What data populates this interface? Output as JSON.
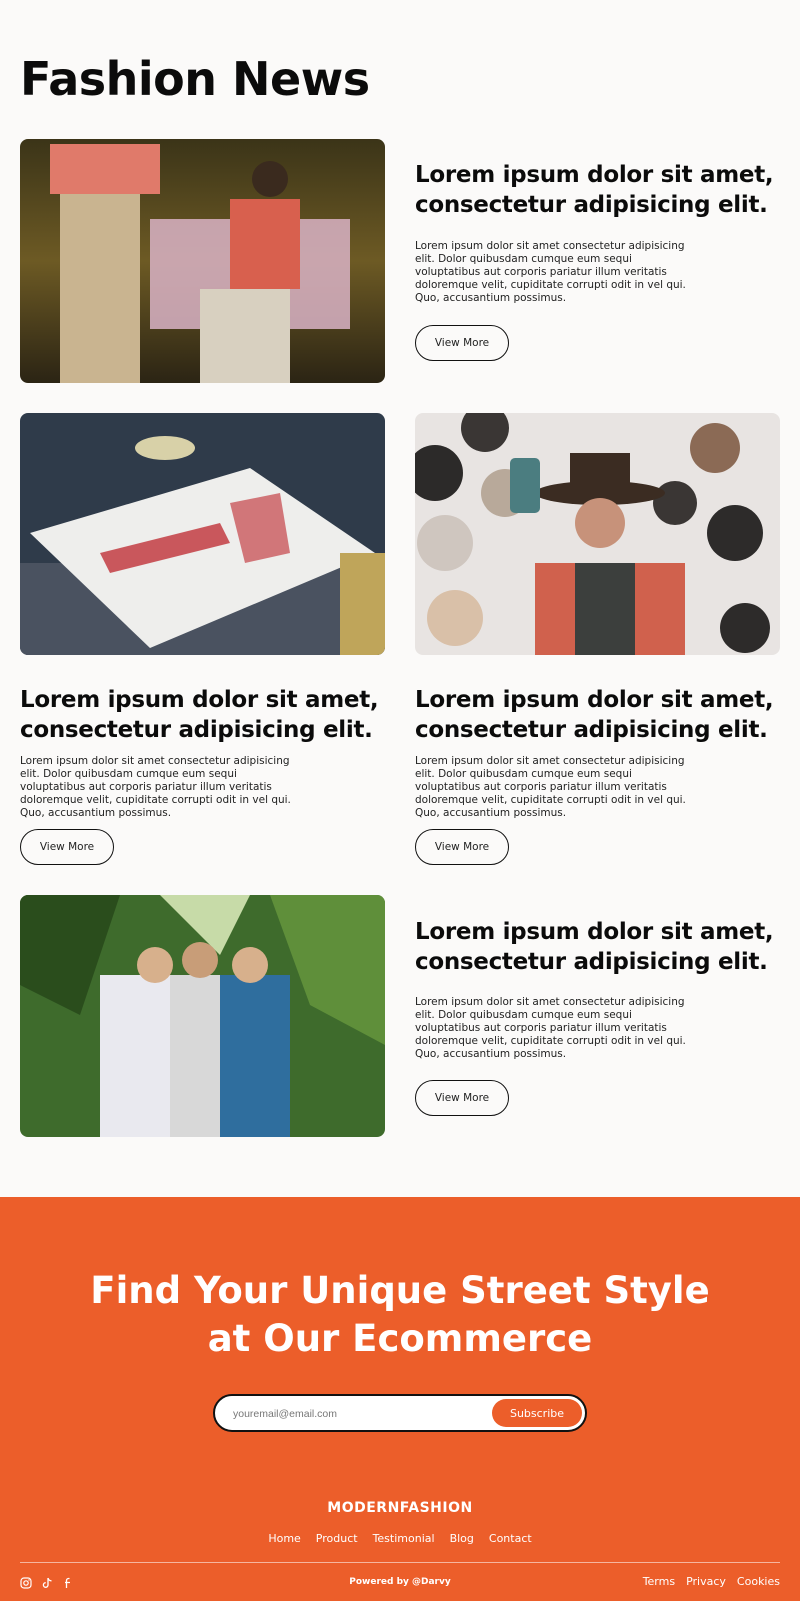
{
  "page": {
    "title": "Fashion News"
  },
  "posts": [
    {
      "title": "Lorem ipsum dolor sit amet, consectetur adipisicing elit.",
      "body": "Lorem ipsum dolor sit amet consectetur adipisicing elit. Dolor quibusdam cumque eum sequi voluptatibus aut corporis pariatur illum veritatis doloremque velit, cupiditate corrupti odit in vel qui. Quo, accusantium possimus.",
      "button": "View More"
    },
    {
      "title": "Lorem ipsum dolor sit amet, consectetur adipisicing elit.",
      "body": "Lorem ipsum dolor sit amet consectetur adipisicing elit. Dolor quibusdam cumque eum sequi voluptatibus aut corporis pariatur illum veritatis doloremque velit, cupiditate corrupti odit in vel qui. Quo, accusantium possimus.",
      "button": "View More"
    },
    {
      "title": "Lorem ipsum dolor sit amet, consectetur adipisicing elit.",
      "body": "Lorem ipsum dolor sit amet consectetur adipisicing elit. Dolor quibusdam cumque eum sequi voluptatibus aut corporis pariatur illum veritatis doloremque velit, cupiditate corrupti odit in vel qui. Quo, accusantium possimus.",
      "button": "View More"
    },
    {
      "title": "Lorem ipsum dolor sit amet, consectetur adipisicing elit.",
      "body": "Lorem ipsum dolor sit amet consectetur adipisicing elit. Dolor quibusdam cumque eum sequi voluptatibus aut corporis pariatur illum veritatis doloremque velit, cupiditate corrupti odit in vel qui. Quo, accusantium possimus.",
      "button": "View More"
    }
  ],
  "cta": {
    "title_line1": "Find Your Unique Street Style",
    "title_line2": "at Our Ecommerce",
    "email_placeholder": "youremail@email.com",
    "subscribe_label": "Subscribe"
  },
  "footer": {
    "brand": "MODERNFASHION",
    "nav": [
      "Home",
      "Product",
      "Testimonial",
      "Blog",
      "Contact"
    ],
    "powered_by": "Powered by @Darvy",
    "legal": [
      "Terms",
      "Privacy",
      "Cookies"
    ],
    "socials": [
      "instagram-icon",
      "tiktok-icon",
      "facebook-icon"
    ]
  },
  "colors": {
    "accent": "#ec5e2a",
    "background": "#fbfaf9",
    "text": "#0b0b0b"
  }
}
